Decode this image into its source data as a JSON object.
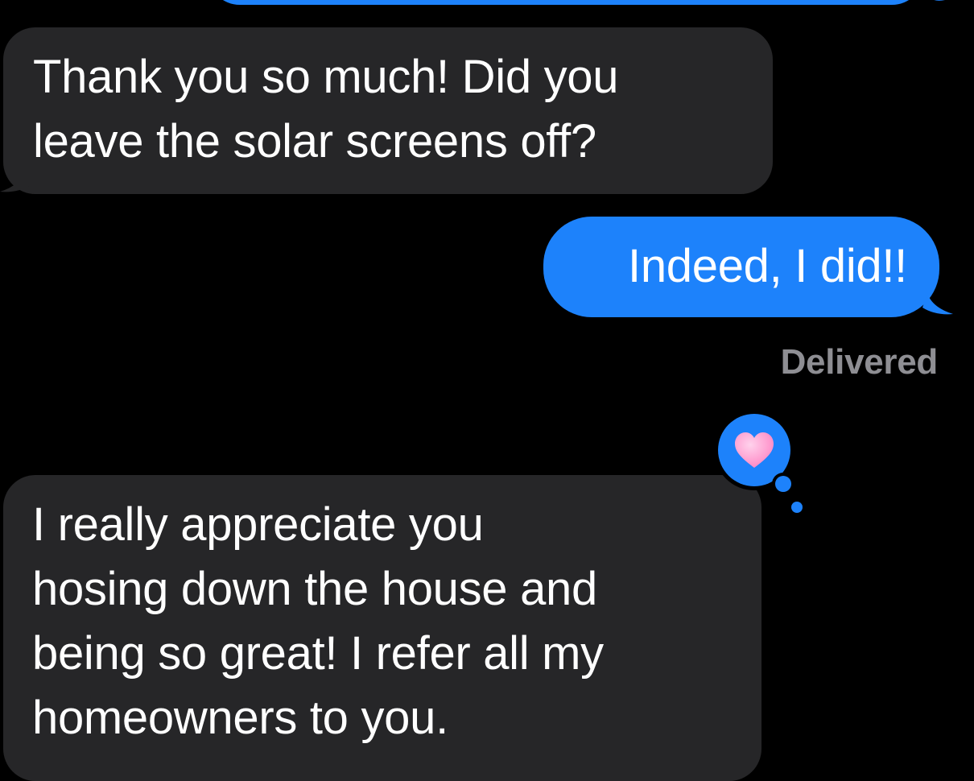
{
  "conversation": {
    "messages": [
      {
        "direction": "incoming",
        "lines": [
          "Thank you so much! Did you",
          "leave the solar screens off?"
        ]
      },
      {
        "direction": "outgoing",
        "lines": [
          "Indeed, I did!!"
        ]
      },
      {
        "direction": "incoming",
        "lines": [
          "I really appreciate you",
          "hosing down the house and",
          "being so great! I refer all my",
          "homeowners to you."
        ],
        "reaction": "heart"
      }
    ],
    "delivery_status": "Delivered"
  },
  "colors": {
    "background": "#000000",
    "incoming_bubble": "#262628",
    "outgoing_bubble": "#1d82fb",
    "status_text": "#8e8e93",
    "heart": "#ff8fc8"
  }
}
